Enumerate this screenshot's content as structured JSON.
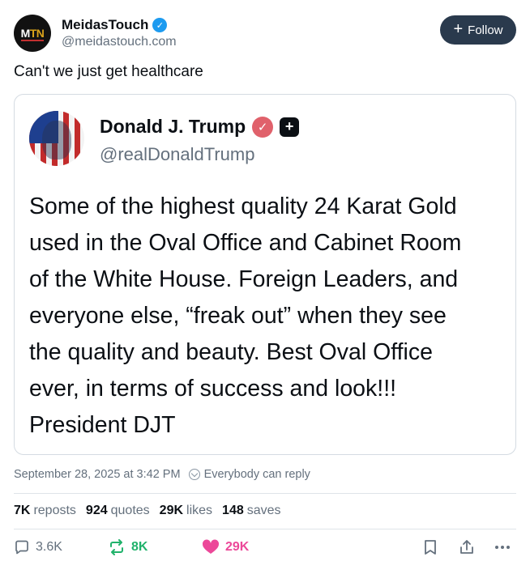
{
  "author": {
    "avatar_text_1": "M",
    "avatar_text_2": "TN",
    "name": "MeidasTouch",
    "handle": "@meidastouch.com",
    "verified_icon": "check"
  },
  "follow": {
    "label": "Follow",
    "icon": "+"
  },
  "post": {
    "text": "Can't we just get healthcare"
  },
  "quote": {
    "name": "Donald J. Trump",
    "handle": "@realDonaldTrump",
    "verified_icon": "check",
    "extra_badge": "+",
    "body": "Some of the highest quality 24 Karat Gold\nused in the Oval Office and Cabinet Room\nof the White House. Foreign Leaders, and\neveryone else, “freak out” when they see\nthe quality and beauty. Best Oval Office\never, in terms of success and look!!!\nPresident DJT"
  },
  "meta": {
    "timestamp": "September 28, 2025 at 3:42 PM",
    "reply_setting": "Everybody can reply"
  },
  "stats": [
    {
      "count": "7K",
      "label": "reposts"
    },
    {
      "count": "924",
      "label": "quotes"
    },
    {
      "count": "29K",
      "label": "likes"
    },
    {
      "count": "148",
      "label": "saves"
    }
  ],
  "actions": {
    "replies": "3.6K",
    "reposts": "8K",
    "likes": "29K"
  },
  "colors": {
    "repost_green": "#20b26b",
    "like_pink": "#ec4899",
    "muted": "#64707d",
    "follow_bg": "#2a3a4d"
  }
}
